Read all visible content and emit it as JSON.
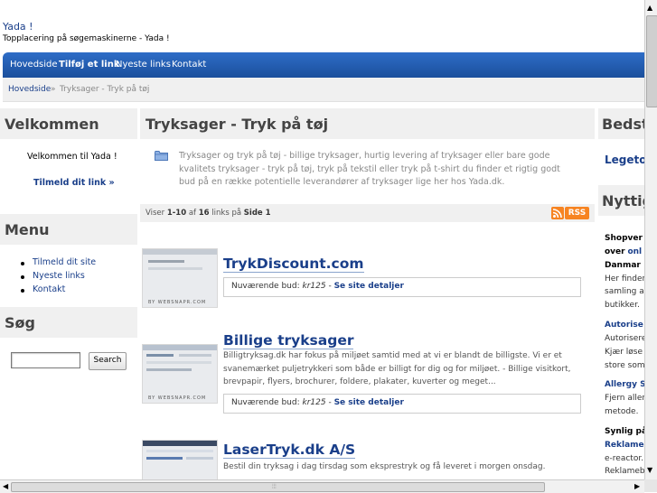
{
  "header": {
    "site_name": "Yada !",
    "tagline": "Topplacering på søgemaskinerne - Yada !"
  },
  "nav": {
    "items": [
      "Hovedside",
      "Tilføj et link",
      "Nyeste links",
      "Kontakt"
    ],
    "active_index": 1
  },
  "breadcrumb": {
    "home": "Hovedside",
    "separator": "»",
    "current": "Tryksager - Tryk på tøj"
  },
  "left_sidebar": {
    "welcome": {
      "title": "Velkommen",
      "text": "Velkommen til Yada !",
      "link": "Tilmeld dit link »"
    },
    "menu": {
      "title": "Menu",
      "items": [
        "Tilmeld dit site",
        "Nyeste links",
        "Kontakt"
      ]
    },
    "search": {
      "title": "Søg",
      "input_value": "",
      "button_label": "Search"
    }
  },
  "main": {
    "title": "Tryksager - Tryk på tøj",
    "intro": "Tryksager og tryk på tøj - billige tryksager, hurtig levering af tryksager eller bare gode kvalitets tryksager - tryk på tøj, tryk på tekstil eller tryk på t-shirt du finder et rigtig godt bud på en række potentielle leverandører af tryksager lige her hos Yada.dk.",
    "count": {
      "prefix": "Viser",
      "range": "1-10",
      "of_label": "af",
      "total": "16",
      "links_label": "links på",
      "page_label": "Side",
      "page": "1"
    },
    "rss_label": "RSS",
    "thumb_caption": "BY WEBSNAPR.COM",
    "bid_label": "Nuværende bud:",
    "details_link": "Se site detaljer",
    "listings": [
      {
        "title": "TrykDiscount.com",
        "description": "",
        "bid": "kr125"
      },
      {
        "title": "Billige tryksager",
        "description": "Billigtryksag.dk har fokus på miljøet samtid med at vi er blandt de billigste. Vi er et svanemærket puljetrykkeri som både er billigt for dig og for miljøet. - Billige visitkort, brevpapir, flyers, brochurer, foldere, plakater, kuverter og meget...",
        "bid": "kr125"
      },
      {
        "title": "LaserTryk.dk A/S",
        "description": "Bestil din tryksag i dag tirsdag som eksprestryk og få leveret i morgen onsdag.",
        "bid": ""
      }
    ]
  },
  "right_sidebar": {
    "title1": "Bedste",
    "link1": "Legeto",
    "title2": "Nyttige",
    "lines": [
      {
        "text": "Shopver",
        "style": "bold"
      },
      {
        "text": "over",
        "style": "bold",
        "suffix": "onl",
        "suffix_style": "link"
      },
      {
        "text": "Danmar",
        "style": "bold"
      },
      {
        "text": "Her finder",
        "style": "plain"
      },
      {
        "text": "samling a",
        "style": "plain"
      },
      {
        "text": "butikker.",
        "style": "plain"
      },
      {
        "text": "Autorise",
        "style": "link"
      },
      {
        "text": "Autorisere",
        "style": "plain"
      },
      {
        "text": "Kjær løse",
        "style": "plain"
      },
      {
        "text": "store som",
        "style": "plain"
      },
      {
        "text": "Allergy S",
        "style": "link"
      },
      {
        "text": "Fjern aller",
        "style": "plain"
      },
      {
        "text": "metode.",
        "style": "plain"
      },
      {
        "text": "Synlig på",
        "style": "bold"
      },
      {
        "text": "Reklame",
        "style": "link"
      },
      {
        "text": "e-reactor.",
        "style": "plain"
      },
      {
        "text": "Reklameb",
        "style": "plain"
      }
    ]
  },
  "colors": {
    "nav_bg": "#1b4f9c",
    "link": "#1a3f8a",
    "panel_bg": "#f0f0f0",
    "rss": "#f78422"
  }
}
